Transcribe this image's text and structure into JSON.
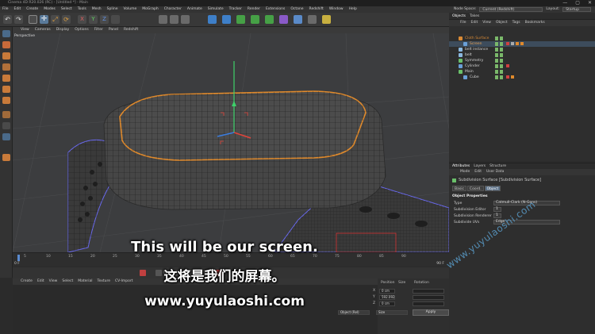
{
  "window": {
    "title": "Cinema 4D R20.026 (RC) - [Untitled *] - Main",
    "controls": [
      "—",
      "▢",
      "✕"
    ]
  },
  "menubar": [
    "File",
    "Edit",
    "Create",
    "Modes",
    "Select",
    "Tools",
    "Mesh",
    "Spline",
    "Volume",
    "MoGraph",
    "Character",
    "Animate",
    "Simulate",
    "Tracker",
    "Render",
    "Extensions",
    "Octane",
    "Redshift",
    "Window",
    "Help"
  ],
  "node_space": {
    "label": "Node Space:",
    "value": "Current (Redshift)"
  },
  "layout": {
    "label": "Layout:",
    "value": "Startup"
  },
  "viewport": {
    "menu": [
      "View",
      "Cameras",
      "Display",
      "Options",
      "Filter",
      "Panel",
      "Redshift"
    ],
    "camera_label": "Perspective"
  },
  "timeline": {
    "ticks": [
      "0",
      "5",
      "10",
      "15",
      "20",
      "25",
      "30",
      "35",
      "40",
      "45",
      "50",
      "55",
      "60",
      "65",
      "70",
      "75",
      "80",
      "85",
      "90"
    ],
    "start_frame": "0 F",
    "end_frame": "90 F"
  },
  "material_manager": {
    "menu": [
      "Create",
      "Edit",
      "View",
      "Select",
      "Material",
      "Texture",
      "CV-Import"
    ]
  },
  "coordinates": {
    "headers": [
      "Position",
      "Size",
      "Rotation"
    ],
    "x_label": "X",
    "y_label": "Y",
    "z_label": "Z",
    "size_x": "0 cm",
    "size_y": "592.092",
    "size_z": "0 cm",
    "mode_object": "Object (Rel)",
    "mode_size": "Size",
    "apply": "Apply"
  },
  "object_manager": {
    "tabs": [
      "Objects",
      "Takes"
    ],
    "menu": [
      "File",
      "Edit",
      "View",
      "Object",
      "Tags",
      "Bookmarks"
    ],
    "items": [
      {
        "name": "Cloth Surface",
        "indent": 1,
        "color": "#d98a35",
        "selected": false
      },
      {
        "name": "Screen",
        "indent": 2,
        "color": "#6aa0d8",
        "selected": true
      },
      {
        "name": "belt instance",
        "indent": 1,
        "color": "#8ab8e0",
        "selected": false
      },
      {
        "name": "belt",
        "indent": 1,
        "color": "#8ab8e0",
        "selected": false
      },
      {
        "name": "Symmetry",
        "indent": 1,
        "color": "#6ac06a",
        "selected": false
      },
      {
        "name": "Cylinder",
        "indent": 1,
        "color": "#6aa0d8",
        "selected": false
      },
      {
        "name": "Main",
        "indent": 1,
        "color": "#6ac06a",
        "selected": false
      },
      {
        "name": "Cube",
        "indent": 2,
        "color": "#6aa0d8",
        "selected": false
      }
    ]
  },
  "attributes": {
    "tabs": [
      "Attributes",
      "Layers",
      "Structure"
    ],
    "menu": [
      "Mode",
      "Edit",
      "User Data"
    ],
    "object_title": "Subdivision Surface [Subdivision Surface]",
    "subtabs": [
      "Basic",
      "Coord.",
      "Object"
    ],
    "active_subtab": "Object",
    "section": "Object Properties",
    "props": [
      {
        "label": "Type",
        "value": "Catmull-Clark (N-Gons)"
      },
      {
        "label": "Subdivision Editor",
        "value": "1"
      },
      {
        "label": "Subdivision Renderer",
        "value": "1"
      },
      {
        "label": "Subdivide UVs",
        "value": "Edge"
      }
    ]
  },
  "subtitles": {
    "english": "This will be our screen.",
    "chinese": "这将是我们的屏幕。",
    "url": "www.yuyulaoshi.com"
  },
  "watermark": "www.yuyulaoshi.com",
  "colors": {
    "accent_orange": "#e08a2c",
    "axis_green": "#3ed16a",
    "axis_red": "#e0443a",
    "axis_blue": "#3a7de0",
    "selection": "#3d4c5c"
  }
}
